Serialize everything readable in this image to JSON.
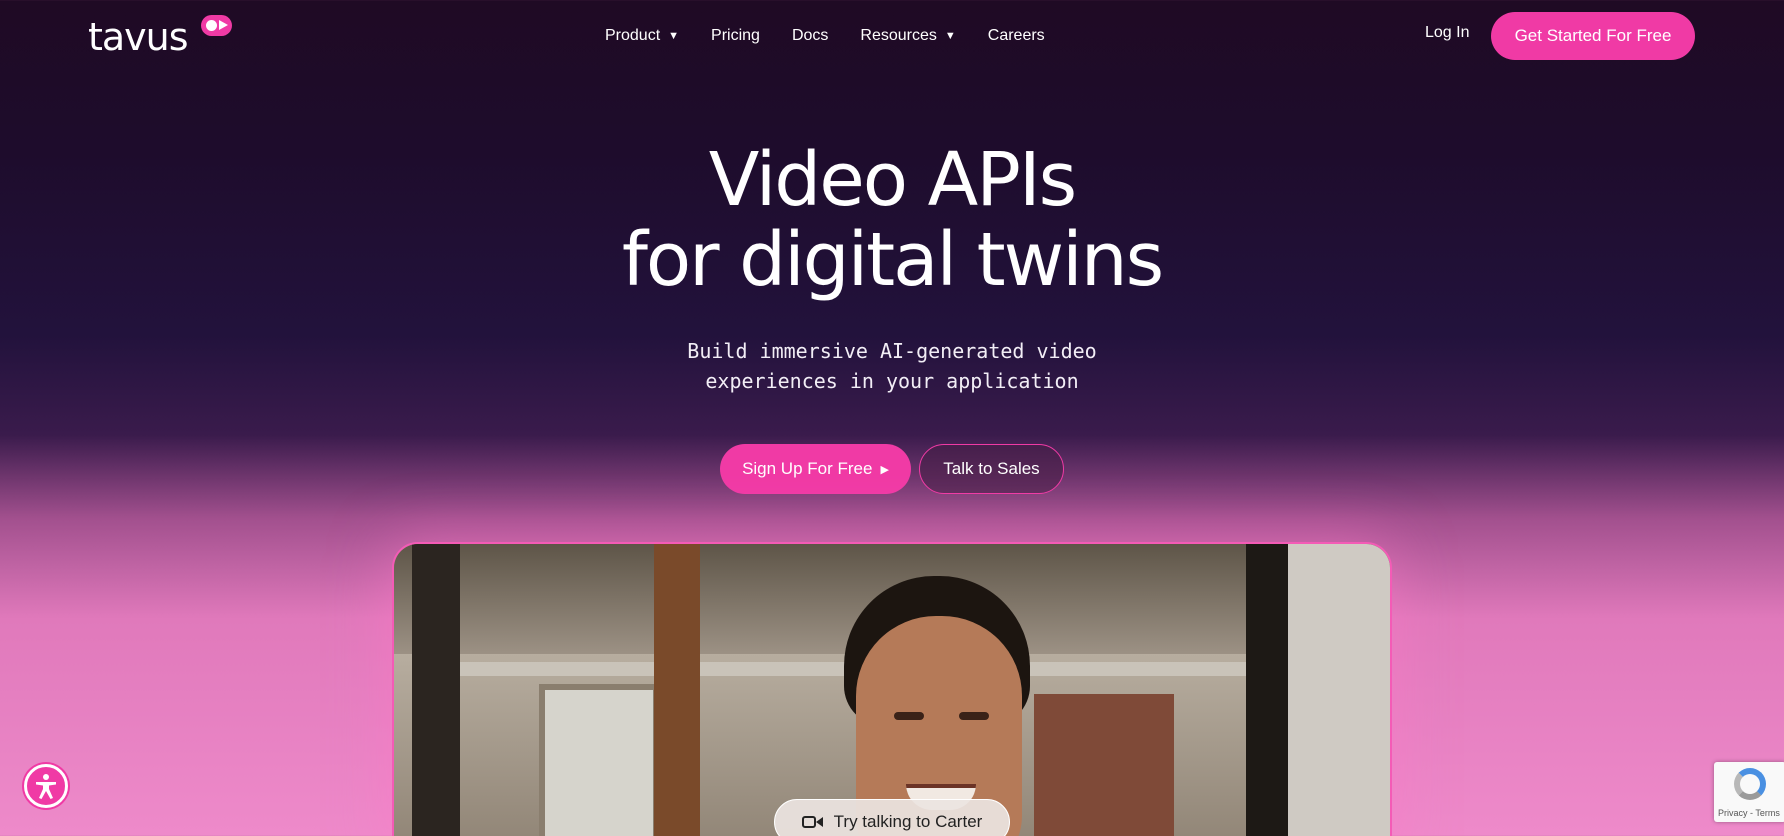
{
  "brand": {
    "name": "tavus",
    "accent": "#f03aa5"
  },
  "nav": {
    "items": [
      {
        "label": "Product",
        "dropdown": true
      },
      {
        "label": "Pricing",
        "dropdown": false
      },
      {
        "label": "Docs",
        "dropdown": false
      },
      {
        "label": "Resources",
        "dropdown": true
      },
      {
        "label": "Careers",
        "dropdown": false
      }
    ],
    "login_label": "Log In",
    "cta_label": "Get Started For Free",
    "caret": "▼"
  },
  "hero": {
    "title_line1": "Video APIs",
    "title_line2": "for digital twins",
    "subtitle_line1": "Build immersive AI-generated video",
    "subtitle_line2": "experiences in your application",
    "signup_label": "Sign Up For Free",
    "signup_icon": "▶",
    "sales_label": "Talk to Sales"
  },
  "video": {
    "talk_label": "Try talking to Carter",
    "talk_icon": "video-camera-icon"
  },
  "recaptcha": {
    "terms": "Privacy - Terms"
  }
}
